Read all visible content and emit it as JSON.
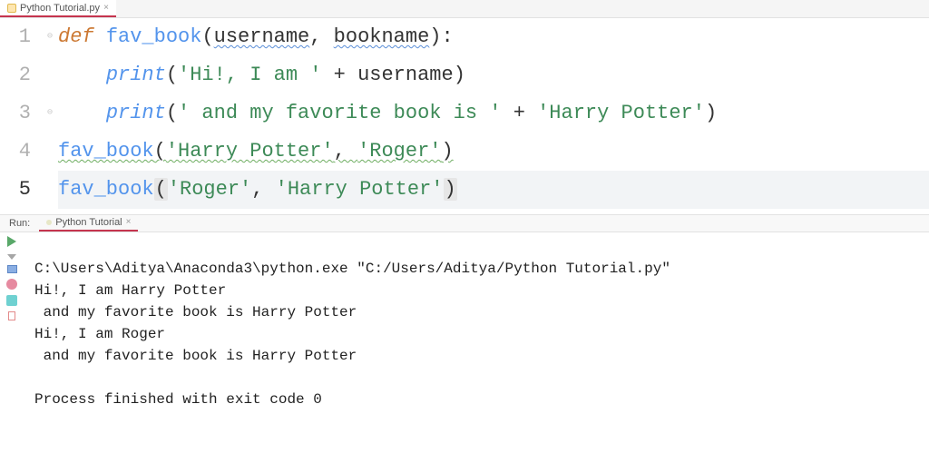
{
  "editor": {
    "tab": {
      "filename": "Python Tutorial.py"
    },
    "code": {
      "line1": {
        "num": "1",
        "kw_def": "def",
        "fn_name": "fav_book",
        "lparen": "(",
        "arg1": "username",
        "comma": ", ",
        "arg2": "bookname",
        "rparen_colon": "):"
      },
      "line2": {
        "num": "2",
        "indent": "    ",
        "fn_print": "print",
        "lparen": "(",
        "str": "'Hi!, I am '",
        "plus": " + ",
        "var": "username",
        "rparen": ")"
      },
      "line3": {
        "num": "3",
        "indent": "    ",
        "fn_print": "print",
        "lparen": "(",
        "str1": "' and my favorite book is '",
        "plus": " + ",
        "str2": "'Harry Potter'",
        "rparen": ")"
      },
      "line4": {
        "num": "4",
        "fn": "fav_book",
        "lparen": "(",
        "str1": "'Harry Potter'",
        "comma": ", ",
        "str2": "'Roger'",
        "rparen": ")"
      },
      "line5": {
        "num": "5",
        "fn": "fav_book",
        "lparen": "(",
        "str1": "'Roger'",
        "comma": ", ",
        "str2": "'Harry Potter'",
        "rparen": ")"
      }
    }
  },
  "run": {
    "label": "Run:",
    "tab": "Python Tutorial",
    "output": {
      "l1": "C:\\Users\\Aditya\\Anaconda3\\python.exe \"C:/Users/Aditya/Python Tutorial.py\"",
      "l2": "Hi!, I am Harry Potter",
      "l3": " and my favorite book is Harry Potter",
      "l4": "Hi!, I am Roger",
      "l5": " and my favorite book is Harry Potter",
      "l6": "",
      "l7": "Process finished with exit code 0"
    }
  }
}
